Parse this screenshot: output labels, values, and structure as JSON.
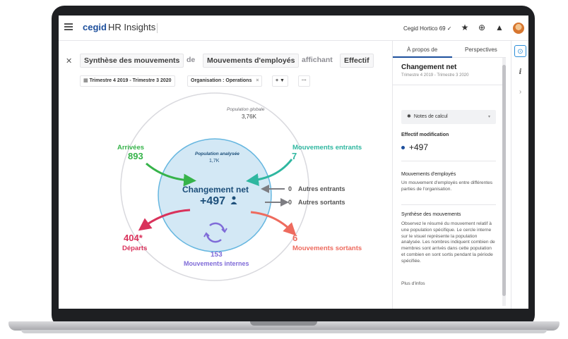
{
  "topbar": {
    "brand": "cegid",
    "product": "HR Insights",
    "tenant": "Cegid Hortico 69 ✓",
    "icons": [
      "menu-icon",
      "star-icon",
      "globe-icon",
      "bell-icon",
      "avatar"
    ]
  },
  "breadcrumb": {
    "chip1": "Synthèse des mouvements",
    "word1": "de",
    "chip2": "Mouvements d'employés",
    "word2": "affichant",
    "chip3": "Effectif"
  },
  "filters": {
    "period": "Trimestre 4 2019 - Trimestre 3 2020",
    "org": "Organisation : Operations",
    "org_close": "×",
    "add": "+ ▼",
    "more": "···"
  },
  "diagram": {
    "global_label": "Population globale",
    "global_value": "3,76K",
    "analysed_label": "Population analysée",
    "analysed_value": "1,7K",
    "center_title": "Changement net",
    "center_value": "+497",
    "arrivals_label": "Arrivées",
    "arrivals_value": "893",
    "in_label": "Mouvements entrants",
    "in_value": "7",
    "other_in_value": "0",
    "other_in_label": "Autres entrants",
    "other_out_value": "0",
    "other_out_label": "Autres sortants",
    "departures_value": "404*",
    "departures_label": "Départs",
    "out_value": "6",
    "out_label": "Mouvements sortants",
    "internal_value": "153",
    "internal_label": "Mouvements internes",
    "colors": {
      "arrivals": "#36b34a",
      "in": "#2fb7a0",
      "departures": "#d9325b",
      "out": "#ee6b5e",
      "internal": "#7f6bd8",
      "center": "#1d4f7a",
      "inner_fill": "#d3e8f5",
      "inner_stroke": "#67b7e0"
    }
  },
  "panel": {
    "tab_about": "À propos de",
    "tab_perspectives": "Perspectives",
    "title": "Changement net",
    "subtitle": "Trimestre 4 2019 - Trimestre 3 2020",
    "notes_label": "Notes de calcul",
    "effectif_heading": "Effectif modification",
    "effectif_value": "+497",
    "mvt_heading": "Mouvements d'employés",
    "mvt_text": "Un mouvement d'employés entre différentes parties de l'organisation.",
    "synth_heading": "Synthèse des mouvements",
    "synth_text": "Observez le résumé du mouvement relatif à une population spécifique. Le cercle interne sur le visuel représente la population analysée. Les nombres indiquent combien de membres sont arrivés dans cette population et combien en sont sortis pendant la période spécifiée.",
    "more_link": "Plus d'infos"
  },
  "rail": {
    "btn1": "⊙",
    "btn2": "i",
    "btn3": "›"
  }
}
